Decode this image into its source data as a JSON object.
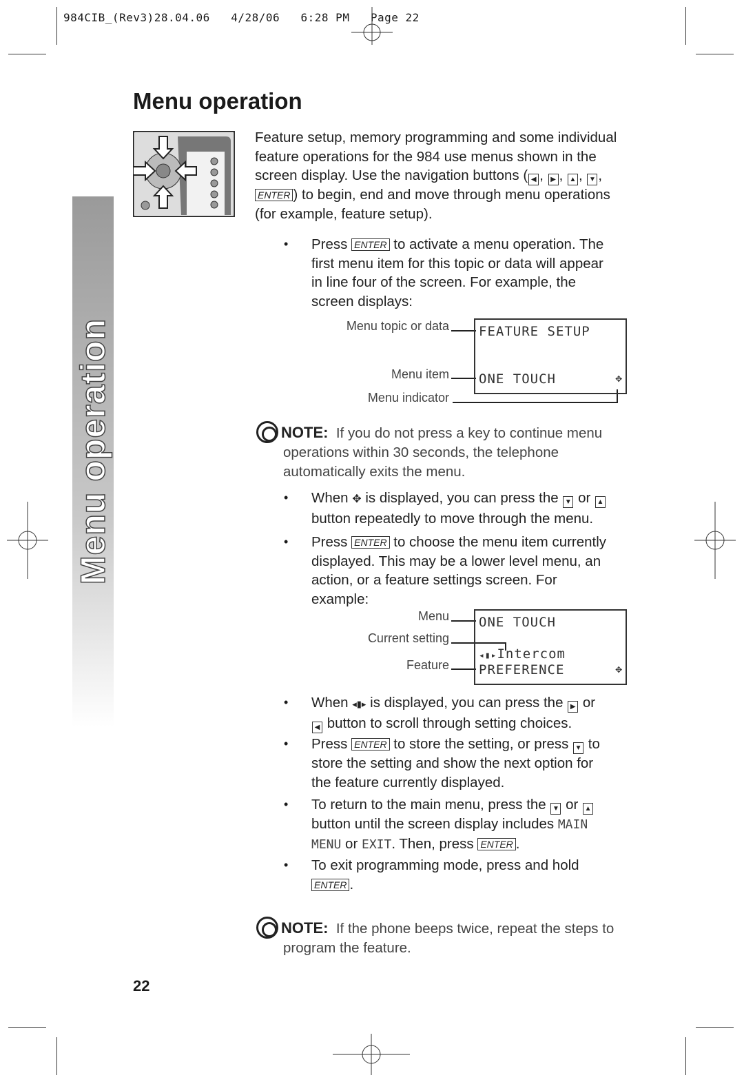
{
  "header": "984CIB_(Rev3)28.04.06   4/28/06   6:28 PM   Page 22",
  "title": "Menu operation",
  "side_tab": "Menu operation",
  "intro": [
    "Feature setup, memory programming and some individual",
    "feature operations for the 984 use menus shown in the",
    "screen display.  Use the navigation buttons (",
    ", ",
    ", ",
    ", ",
    ",",
    ") to begin, end and move through menu operations",
    "(for example, feature setup)."
  ],
  "enter": "ENTER",
  "keys": {
    "left": "◀",
    "right": "▶",
    "up": "▲",
    "down": "▼"
  },
  "b1": [
    "Press ",
    " to activate a menu operation.  The",
    "first menu item for this topic or data will appear",
    "in line four of the screen.  For example, the",
    "screen displays:"
  ],
  "lcd1": {
    "line1": "FEATURE SETUP",
    "line4": "ONE TOUCH",
    "labels": [
      "Menu topic or data",
      "Menu item",
      "Menu indicator"
    ]
  },
  "note1": {
    "label": "NOTE:",
    "text": [
      "If you do not press a key to continue menu",
      "operations within 30 seconds, the telephone",
      "automatically exits the menu."
    ]
  },
  "b2": [
    "When ",
    " is displayed, you can press the ",
    " or ",
    "button repeatedly to move through the menu."
  ],
  "b3": [
    "Press ",
    " to choose the menu item currently",
    "displayed.  This may be a lower level menu, an",
    "action, or a feature settings screen.  For",
    "example:"
  ],
  "lcd2": {
    "line1": "ONE TOUCH",
    "line3": "Intercom",
    "line4": "PREFERENCE",
    "labels": [
      "Menu",
      "Current setting",
      "Feature"
    ]
  },
  "b4": [
    "When ",
    " is displayed, you can press the ",
    " or",
    "button to scroll through setting choices."
  ],
  "b5": [
    "Press ",
    " to store the setting, or press ",
    " to",
    "store the setting and show the next option for",
    "the feature currently displayed."
  ],
  "b6": [
    "To return to the main menu, press the ",
    " or ",
    "button until the screen display includes ",
    "MAIN",
    "MENU",
    " or ",
    "EXIT",
    ".  Then, press ",
    "."
  ],
  "b7": [
    "To exit programming mode, press and hold",
    "."
  ],
  "note2": {
    "label": "NOTE:",
    "text": [
      "If the phone beeps twice, repeat the steps to",
      "program the feature."
    ]
  },
  "page_number": "22",
  "icons": {
    "menu_indicator": "four-way-arrow-icon",
    "setting_indicator": "left-right-arrow-icon",
    "note": "target-icon"
  }
}
